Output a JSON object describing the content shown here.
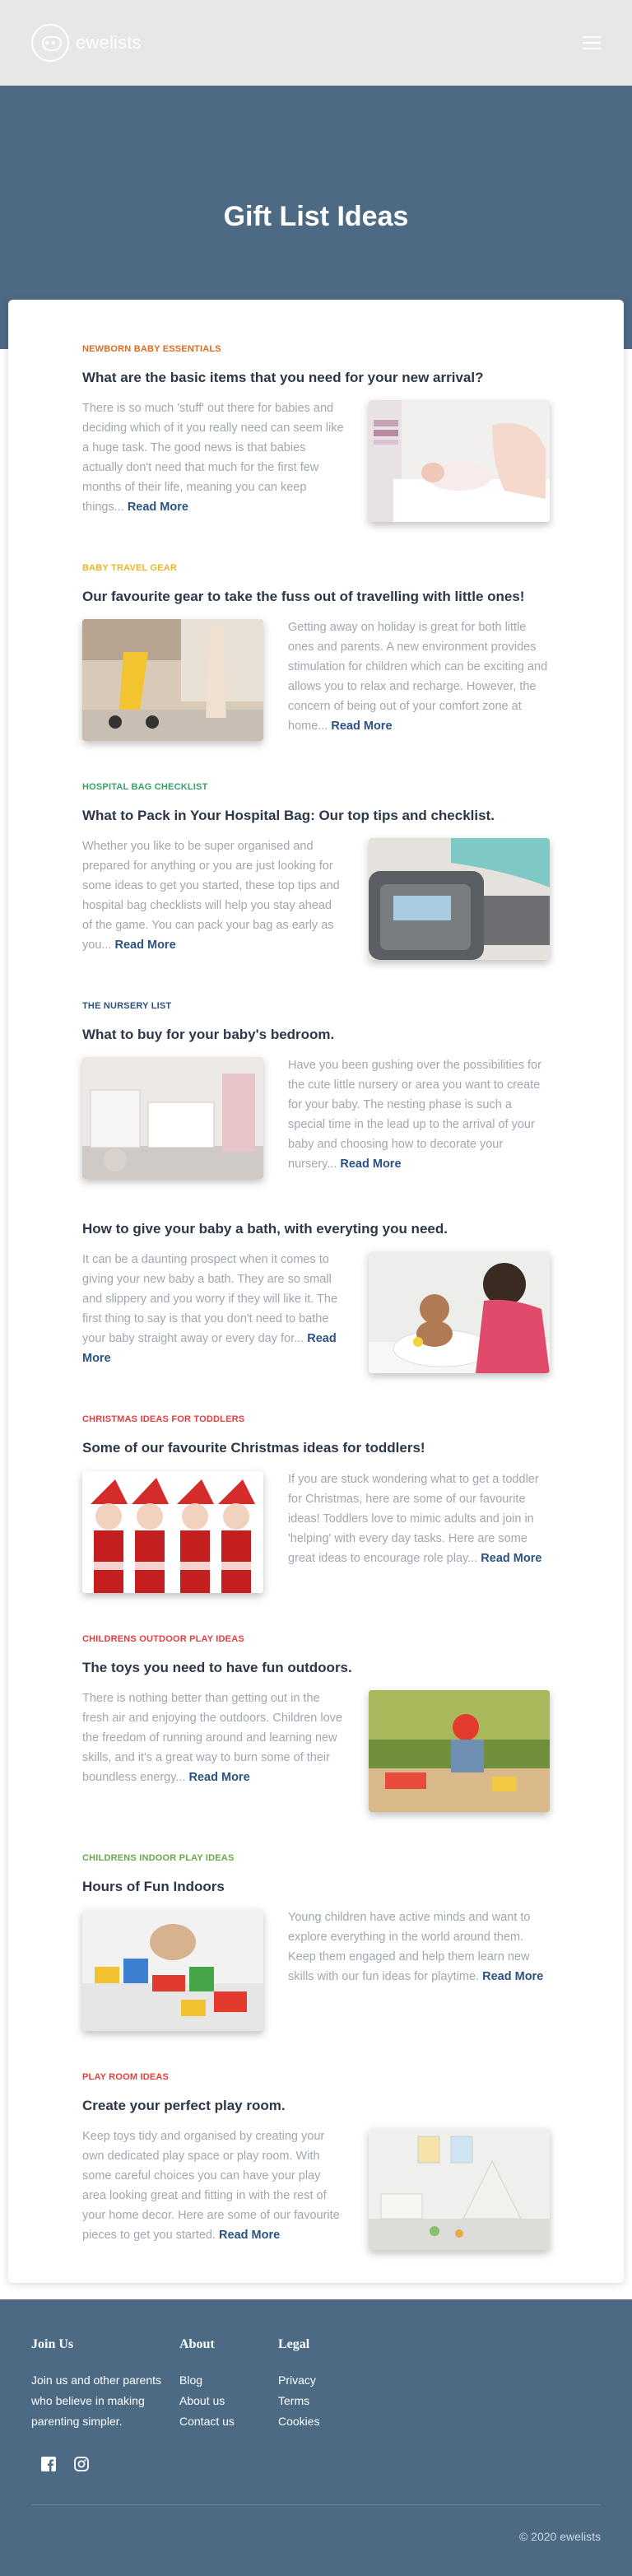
{
  "header": {
    "brand": "ewelists",
    "menu_icon": "hamburger-icon"
  },
  "hero": {
    "title": "Gift List Ideas"
  },
  "articles": [
    {
      "category": "NEWBORN BABY ESSENTIALS",
      "category_color": "#dd6b20",
      "title": "What are the basic items that you need for your new arrival?",
      "text": "There is so much 'stuff' out there for babies and deciding which of it you really need can seem like a huge task. The good news is that babies actually don't need that much for the first few months of their life, meaning you can keep things... ",
      "more": "Read More",
      "image": "newborn-photo"
    },
    {
      "category": "BABY TRAVEL GEAR",
      "category_color": "#f0b429",
      "title": "Our favourite gear to take the fuss out of travelling with little ones!",
      "text": "Getting away on holiday is great for both little ones and parents. A new environment provides stimulation for children which can be exciting and allows you to relax and recharge. However, the concern of being out of your comfort zone at home... ",
      "more": "Read More",
      "image": "stroller-photo"
    },
    {
      "category": "HOSPITAL BAG CHECKLIST",
      "category_color": "#38a169",
      "title": "What to Pack in Your Hospital Bag: Our top tips and checklist.",
      "text": "Whether you like to be super organised and prepared for anything or you are just looking for some ideas to get you started, these top tips and hospital bag checklists will help you stay ahead of the game. You can pack your bag as early as you... ",
      "more": "Read More",
      "image": "hospital-bag-photo"
    },
    {
      "category": "THE NURSERY LIST",
      "category_color": "#2c5282",
      "title": "What to buy for your baby's bedroom.",
      "text": "Have you been gushing over the possibilities for the cute little nursery or area you want to create for your baby. The nesting phase is such a special time in the lead up to the arrival of your baby and choosing how to decorate your nursery... ",
      "more": "Read More",
      "image": "nursery-photo"
    },
    {
      "category": "",
      "category_color": "#2c5282",
      "title": "How to give your baby a bath, with everyting you need.",
      "text": "It can be a daunting prospect when it comes to giving your new baby a bath. They are so small and slippery and you worry if they will like it. The first thing to say is that you don't need to bathe your baby straight away or every day for... ",
      "more": "Read More",
      "image": "baby-bath-photo"
    },
    {
      "category": "CHRISTMAS IDEAS FOR TODDLERS",
      "category_color": "#e53e3e",
      "title": "Some of our favourite Christmas ideas for toddlers!",
      "text": "If you are stuck wondering what to get a toddler for Christmas, here are some of our favourite ideas! Toddlers love to mimic adults and join in 'helping' with every day tasks. Here are some great ideas to encourage role play... ",
      "more": "Read More",
      "image": "christmas-kids-photo"
    },
    {
      "category": "CHILDRENS OUTDOOR PLAY IDEAS",
      "category_color": "#e53e3e",
      "title": "The toys you need to have fun outdoors.",
      "text": "There is nothing better than getting out in the fresh air and enjoying the outdoors. Children love the freedom of running around and learning new skills, and it's a great way to burn some of their boundless energy... ",
      "more": "Read More",
      "image": "outdoor-play-photo"
    },
    {
      "category": "CHILDRENS INDOOR PLAY IDEAS",
      "category_color": "#68a94a",
      "title": "Hours of Fun Indoors",
      "text": "Young children have active minds and want to explore everything in the world around them. Keep them engaged and help them learn new skills with our fun ideas for playtime. ",
      "more": "Read More",
      "image": "building-blocks-photo"
    },
    {
      "category": "PLAY ROOM IDEAS",
      "category_color": "#e53e3e",
      "title": "Create your perfect play room.",
      "text": "Keep toys tidy and organised by creating your own dedicated play space or play room. With some careful choices you can have your play area looking great and fitting in with the rest of your home decor. Here are some of our favourite pieces to get you started. ",
      "more": "Read More",
      "image": "play-room-photo"
    }
  ],
  "footer": {
    "join": {
      "heading": "Join Us",
      "text": "Join us and other parents who believe in making parenting simpler."
    },
    "about": {
      "heading": "About",
      "links": [
        "Blog",
        "About us",
        "Contact us"
      ]
    },
    "legal": {
      "heading": "Legal",
      "links": [
        "Privacy",
        "Terms",
        "Cookies"
      ]
    },
    "social": [
      "facebook-icon",
      "instagram-icon"
    ],
    "copyright": "© 2020 ewelists"
  }
}
